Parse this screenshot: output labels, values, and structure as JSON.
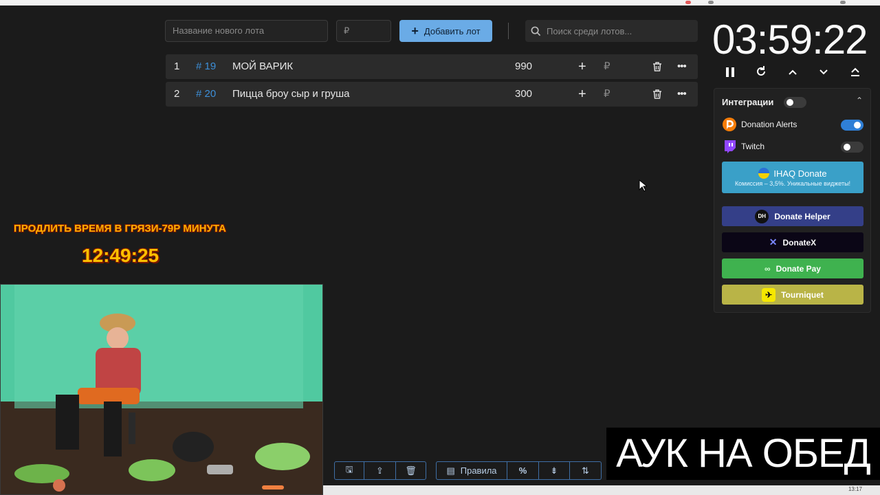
{
  "toolbar": {
    "new_lot_placeholder": "Название нового лота",
    "amount_placeholder": "₽",
    "add_button_label": "Добавить лот",
    "search_placeholder": "Поиск среди лотов..."
  },
  "lots": [
    {
      "index": "1",
      "number": "# 19",
      "name": "МОЙ ВАРИК",
      "amount": "990",
      "currency": "₽"
    },
    {
      "index": "2",
      "number": "# 20",
      "name": "Пицца броу сыр и груша",
      "amount": "300",
      "currency": "₽"
    }
  ],
  "timer": {
    "value": "03:59:22"
  },
  "integrations": {
    "title": "Интеграции",
    "master_enabled": false,
    "items": [
      {
        "label": "Donation Alerts",
        "enabled": true
      },
      {
        "label": "Twitch",
        "enabled": false
      }
    ],
    "services": [
      {
        "label": "IHAQ Donate",
        "sub": "Комиссия – 3,5%. Уникальные виджеты!"
      },
      {
        "label": "Donate Helper"
      },
      {
        "label": "DonateX"
      },
      {
        "label": "Donate Pay"
      },
      {
        "label": "Tourniquet"
      }
    ]
  },
  "overlay": {
    "prolong_text": "ПРОДЛИТЬ ВРЕМЯ В ГРЯЗИ-79Р МИНУТА",
    "clock": "12:49:25"
  },
  "bottom_toolbar": {
    "rules_label": "Правила",
    "percent_label": "%"
  },
  "banner": {
    "text": "АУК НА ОБЕД"
  },
  "taskbar": {
    "time": "13:17"
  },
  "colors": {
    "accent": "#6aabe6",
    "lot_number": "#3d8fd8",
    "overlay_text": "#ffb000"
  }
}
